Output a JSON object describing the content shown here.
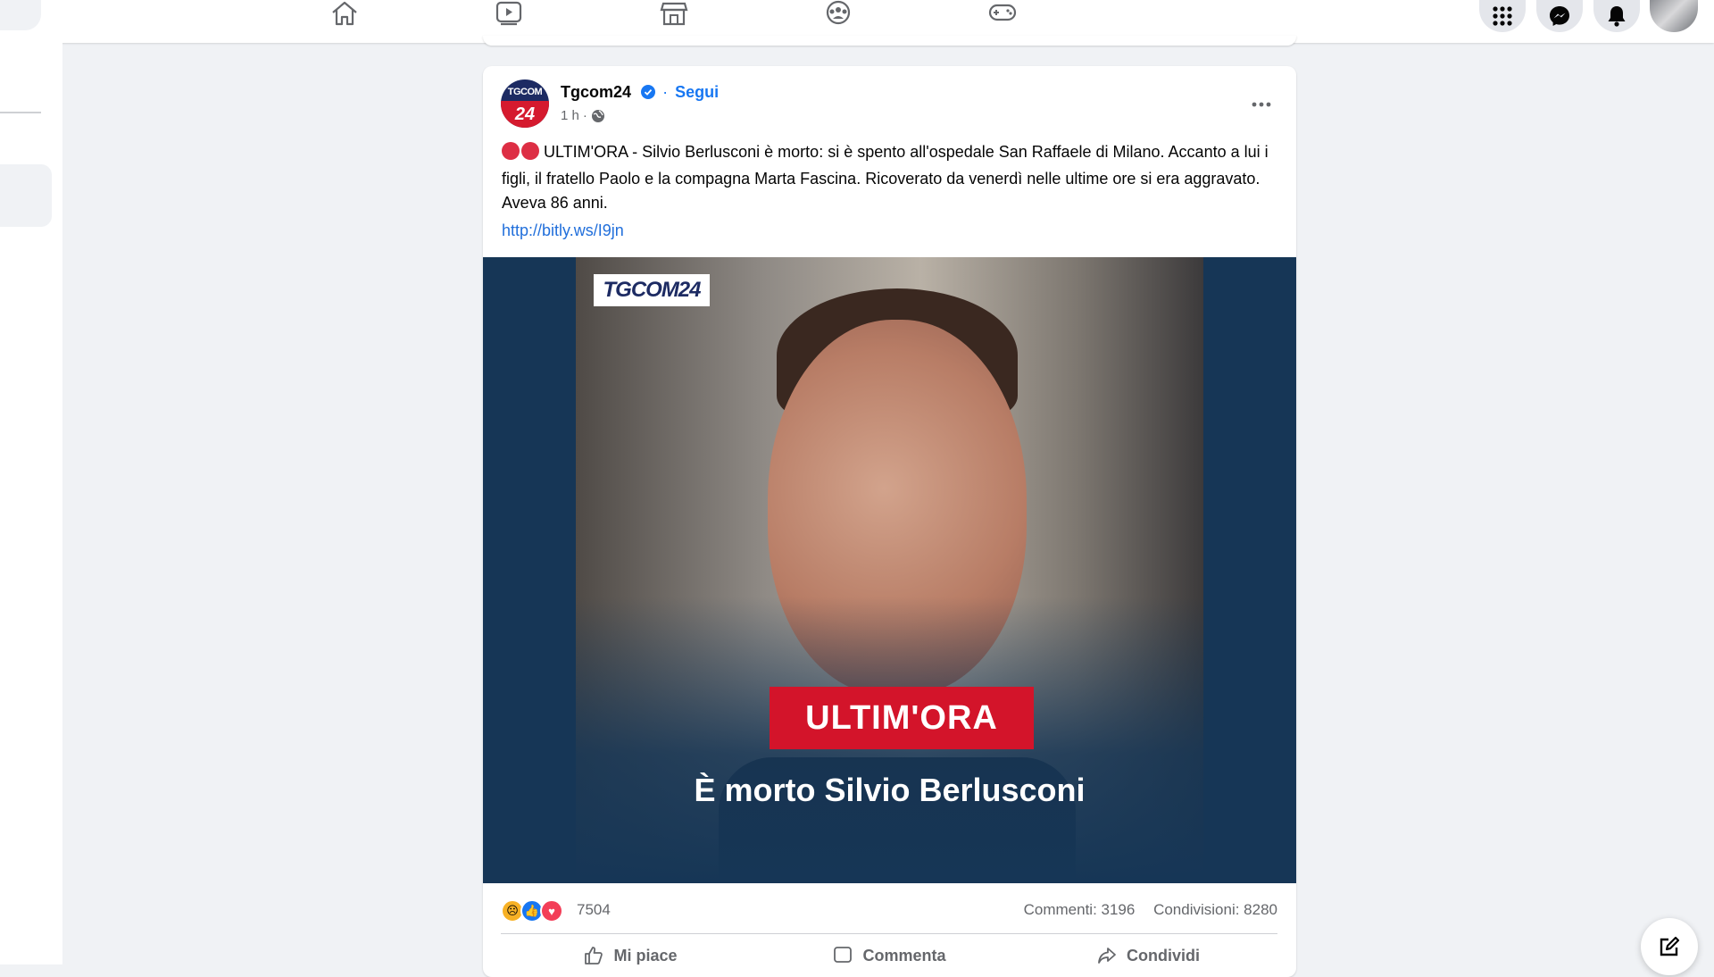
{
  "nav": {
    "icons": [
      "home-icon",
      "watch-icon",
      "marketplace-icon",
      "groups-icon",
      "gaming-icon"
    ],
    "right_icons": [
      "menu-grid-icon",
      "messenger-icon",
      "notifications-icon"
    ]
  },
  "post": {
    "page_name": "Tgcom24",
    "avatar_top": "TGCOM",
    "avatar_bottom": "24",
    "separator": "·",
    "follow_label": "Segui",
    "time": "1 h",
    "time_sep": "·",
    "text": "ULTIM'ORA - Silvio Berlusconi è morto: si è spento all'ospedale San Raffaele di Milano. Accanto a lui i figli, il fratello Paolo e la compagna Marta Fascina. Ricoverato da venerdì nelle ultime ore si era aggravato. Aveva 86 anni.",
    "link": "http://bitly.ws/I9jn",
    "image": {
      "logo": "TGCOM24",
      "badge": "ULTIM'ORA",
      "headline": "È morto Silvio Berlusconi"
    },
    "reaction_count": "7504",
    "comments": "Commenti: 3196",
    "shares": "Condivisioni: 8280",
    "actions": {
      "like": "Mi piace",
      "comment": "Commenta",
      "share": "Condividi"
    }
  },
  "colors": {
    "accent": "#1877f2",
    "badge_red": "#d3142a",
    "image_bg": "#163656"
  }
}
